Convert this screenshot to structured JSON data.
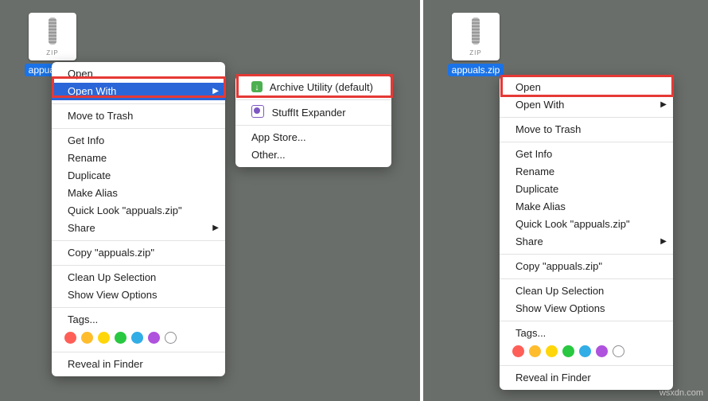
{
  "files": {
    "left": {
      "name": "appuals.zip",
      "ext": "ZIP"
    },
    "right": {
      "name": "appuals.zip",
      "ext": "ZIP"
    }
  },
  "context_menu": {
    "open": "Open",
    "open_with": "Open With",
    "move_to_trash": "Move to Trash",
    "get_info": "Get Info",
    "rename": "Rename",
    "duplicate": "Duplicate",
    "make_alias": "Make Alias",
    "quick_look": "Quick Look \"appuals.zip\"",
    "share": "Share",
    "copy": "Copy \"appuals.zip\"",
    "clean_up": "Clean Up Selection",
    "show_view_options": "Show View Options",
    "tags": "Tags...",
    "reveal": "Reveal in Finder"
  },
  "open_with_submenu": {
    "archive_utility": "Archive Utility (default)",
    "stuffit": "StuffIt Expander",
    "app_store": "App Store...",
    "other": "Other..."
  },
  "tag_colors": [
    "#ff5f57",
    "#ffbd2e",
    "#ffd60a",
    "#28c840",
    "#32ade6",
    "#af52de",
    "#8e8e93"
  ],
  "watermark": "wsxdn.com"
}
